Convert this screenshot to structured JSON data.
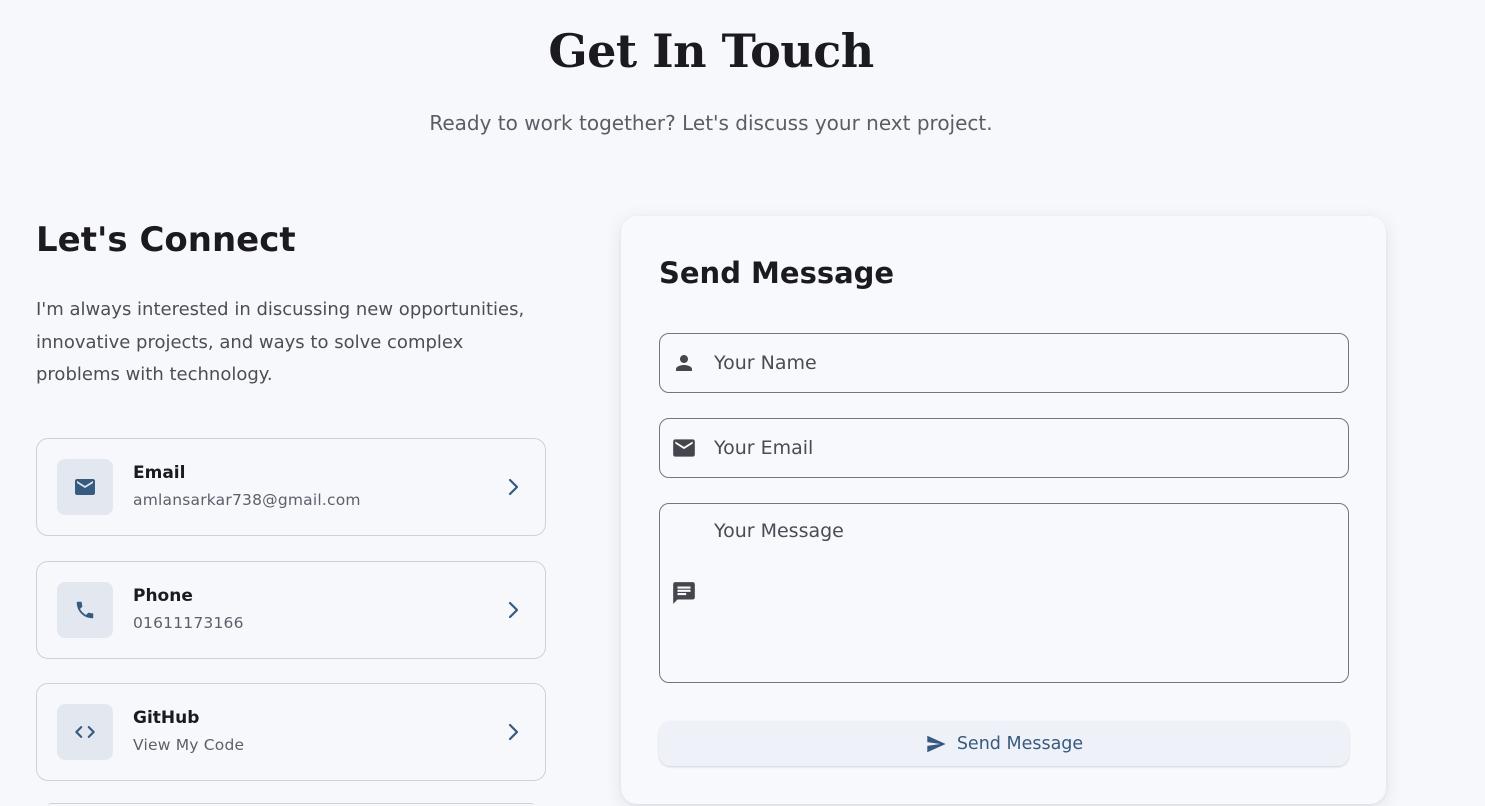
{
  "header": {
    "title": "Get In Touch",
    "subtitle": "Ready to work together? Let's discuss your next project."
  },
  "connect": {
    "title": "Let's Connect",
    "description": "I'm always interested in discussing new opportunities, innovative projects, and ways to solve complex problems with technology.",
    "items": [
      {
        "label": "Email",
        "value": "amlansarkar738@gmail.com",
        "icon": "mail-icon"
      },
      {
        "label": "Phone",
        "value": "01611173166",
        "icon": "phone-icon"
      },
      {
        "label": "GitHub",
        "value": "View My Code",
        "icon": "code-icon"
      }
    ]
  },
  "form": {
    "title": "Send Message",
    "name_placeholder": "Your Name",
    "email_placeholder": "Your Email",
    "message_placeholder": "Your Message",
    "submit_label": "Send Message"
  },
  "colors": {
    "background": "#f7f8fc",
    "accent": "#375a7f",
    "card_border": "#cfd1d8",
    "icon_box": "#e3e7ef"
  }
}
